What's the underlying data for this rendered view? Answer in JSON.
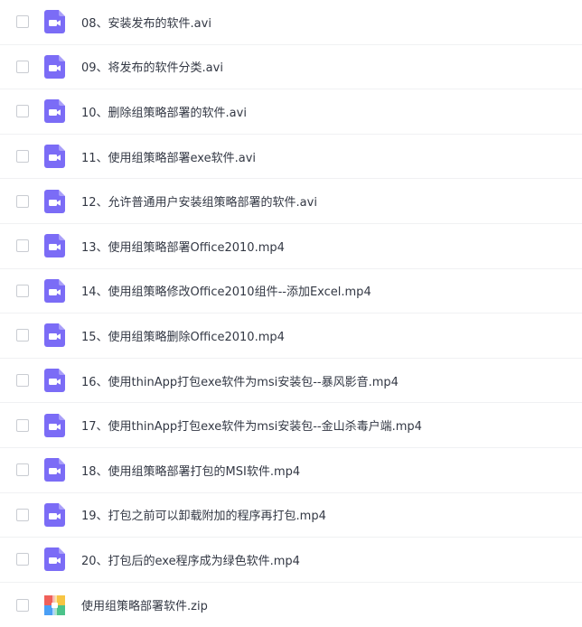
{
  "files": [
    {
      "name": "08、安装发布的软件.avi",
      "type": "video",
      "icon": "video-file-icon"
    },
    {
      "name": "09、将发布的软件分类.avi",
      "type": "video",
      "icon": "video-file-icon"
    },
    {
      "name": "10、删除组策略部署的软件.avi",
      "type": "video",
      "icon": "video-file-icon"
    },
    {
      "name": "11、使用组策略部署exe软件.avi",
      "type": "video",
      "icon": "video-file-icon"
    },
    {
      "name": "12、允许普通用户安装组策略部署的软件.avi",
      "type": "video",
      "icon": "video-file-icon"
    },
    {
      "name": "13、使用组策略部署Office2010.mp4",
      "type": "video",
      "icon": "video-file-icon"
    },
    {
      "name": "14、使用组策略修改Office2010组件--添加Excel.mp4",
      "type": "video",
      "icon": "video-file-icon"
    },
    {
      "name": "15、使用组策略删除Office2010.mp4",
      "type": "video",
      "icon": "video-file-icon"
    },
    {
      "name": "16、使用thinApp打包exe软件为msi安装包--暴风影音.mp4",
      "type": "video",
      "icon": "video-file-icon"
    },
    {
      "name": "17、使用thinApp打包exe软件为msi安装包--金山杀毒户端.mp4",
      "type": "video",
      "icon": "video-file-icon"
    },
    {
      "name": "18、使用组策略部署打包的MSI软件.mp4",
      "type": "video",
      "icon": "video-file-icon"
    },
    {
      "name": "19、打包之前可以卸载附加的程序再打包.mp4",
      "type": "video",
      "icon": "video-file-icon"
    },
    {
      "name": "20、打包后的exe程序成为绿色软件.mp4",
      "type": "video",
      "icon": "video-file-icon"
    },
    {
      "name": "使用组策略部署软件.zip",
      "type": "zip",
      "icon": "zip-file-icon"
    }
  ],
  "colors": {
    "video_icon": "#7b6cf6",
    "zip_red": "#f0605a",
    "zip_yellow": "#f7c543",
    "zip_green": "#4cc38a",
    "zip_blue": "#4a9ff5",
    "text": "#333844",
    "checkbox_border": "#c9ccd2",
    "divider": "#f0f1f3"
  }
}
